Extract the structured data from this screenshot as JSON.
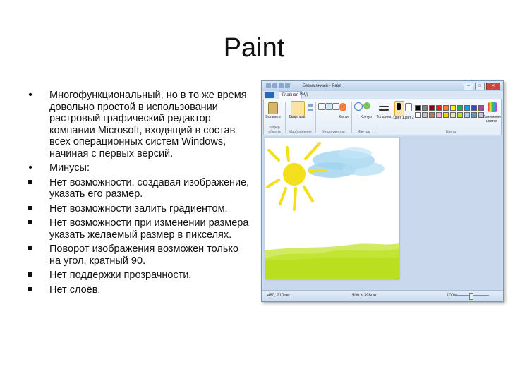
{
  "slide": {
    "title": "Paint",
    "bullets": [
      {
        "style": "round",
        "text": "Многофункциональный, но в то же время довольно простой в использовании растровый графический редактор компании Microsoft, входящий в состав всех операционных систем Windows, начиная с первых версий."
      },
      {
        "style": "round",
        "text": "Минусы:"
      },
      {
        "style": "square",
        "text": "Нет возможности, создавая изображение, указать его размер."
      },
      {
        "style": "square",
        "text": "Нет возможности залить градиентом."
      },
      {
        "style": "square",
        "text": "Нет возможности при изменении размера указать желаемый размер в пикселях."
      },
      {
        "style": "square",
        "text": "Поворот изображения возможен только на угол, кратный 90."
      },
      {
        "style": "square",
        "text": "Нет поддержки прозрачности."
      },
      {
        "style": "square",
        "text": "Нет слоёв."
      }
    ]
  },
  "paint_window": {
    "title": "Безымянный - Paint",
    "minimize": "–",
    "maximize": "□",
    "close": "✕",
    "tabs": [
      "Главная",
      "Вид"
    ],
    "ribbon": {
      "paste": "Вставить",
      "select": "Выделить",
      "shapes": "Кисти",
      "fill": "Контур",
      "thickness": "Толщина",
      "color1": "Цвет 1",
      "color2": "Цвет 2",
      "edit_colors": "Изменение цветов",
      "groups": [
        "Буфер обмена",
        "Изображение",
        "Инструменты",
        "Фигуры",
        "Цвета"
      ]
    },
    "palette_colors": [
      "#000000",
      "#7f7f7f",
      "#880015",
      "#ed1c24",
      "#ff7f27",
      "#fff200",
      "#22b14c",
      "#00a2e8",
      "#3f48cc",
      "#a349a4",
      "#ffffff",
      "#c3c3c3",
      "#b97a57",
      "#ffaec9",
      "#ffc90e",
      "#efe4b0",
      "#b5e61d",
      "#99d9ea",
      "#7092be",
      "#c8bfe7"
    ],
    "status": {
      "cursor": "480, 210пкс",
      "size": "500 × 398пкс",
      "zoom": "100%"
    },
    "colors": {
      "sun": "#f3df1b",
      "sky": "#9fd2ee",
      "grass": "#b9df1e"
    }
  }
}
